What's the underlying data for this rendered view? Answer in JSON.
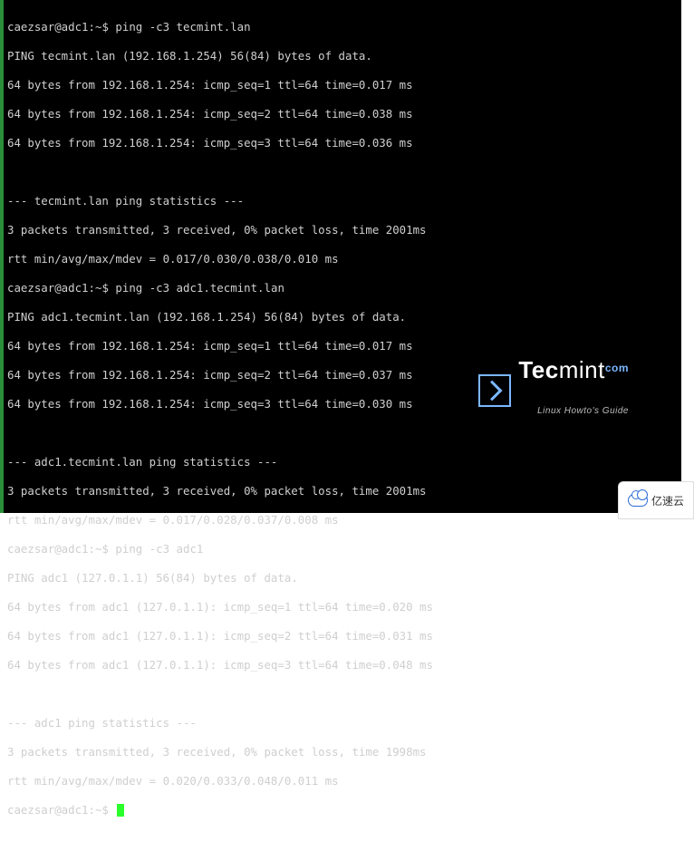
{
  "prompt": {
    "userhost": "caezsar@adc1",
    "path": "~",
    "symbol": "$"
  },
  "commands": {
    "cmd1": "ping -c3 tecmint.lan",
    "cmd2": "ping -c3 adc1.tecmint.lan",
    "cmd3": "ping -c3 adc1"
  },
  "block1": {
    "header": "PING tecmint.lan (192.168.1.254) 56(84) bytes of data.",
    "r1": "64 bytes from 192.168.1.254: icmp_seq=1 ttl=64 time=0.017 ms",
    "r2": "64 bytes from 192.168.1.254: icmp_seq=2 ttl=64 time=0.038 ms",
    "r3": "64 bytes from 192.168.1.254: icmp_seq=3 ttl=64 time=0.036 ms",
    "stats_title": "--- tecmint.lan ping statistics ---",
    "stats1": "3 packets transmitted, 3 received, 0% packet loss, time 2001ms",
    "stats2": "rtt min/avg/max/mdev = 0.017/0.030/0.038/0.010 ms"
  },
  "block2": {
    "header": "PING adc1.tecmint.lan (192.168.1.254) 56(84) bytes of data.",
    "r1": "64 bytes from 192.168.1.254: icmp_seq=1 ttl=64 time=0.017 ms",
    "r2": "64 bytes from 192.168.1.254: icmp_seq=2 ttl=64 time=0.037 ms",
    "r3": "64 bytes from 192.168.1.254: icmp_seq=3 ttl=64 time=0.030 ms",
    "stats_title": "--- adc1.tecmint.lan ping statistics ---",
    "stats1": "3 packets transmitted, 3 received, 0% packet loss, time 2001ms",
    "stats2": "rtt min/avg/max/mdev = 0.017/0.028/0.037/0.008 ms"
  },
  "block3": {
    "header": "PING adc1 (127.0.1.1) 56(84) bytes of data.",
    "r1": "64 bytes from adc1 (127.0.1.1): icmp_seq=1 ttl=64 time=0.020 ms",
    "r2": "64 bytes from adc1 (127.0.1.1): icmp_seq=2 ttl=64 time=0.031 ms",
    "r3": "64 bytes from adc1 (127.0.1.1): icmp_seq=3 ttl=64 time=0.048 ms",
    "stats_title": "--- adc1 ping statistics ---",
    "stats1": "3 packets transmitted, 3 received, 0% packet loss, time 1998ms",
    "stats2": "rtt min/avg/max/mdev = 0.020/0.033/0.048/0.011 ms"
  },
  "watermark": {
    "brand_strong": "Tec",
    "brand_light": "mint",
    "tagline": "Linux Howto's Guide"
  },
  "badge": {
    "text": "亿速云"
  }
}
